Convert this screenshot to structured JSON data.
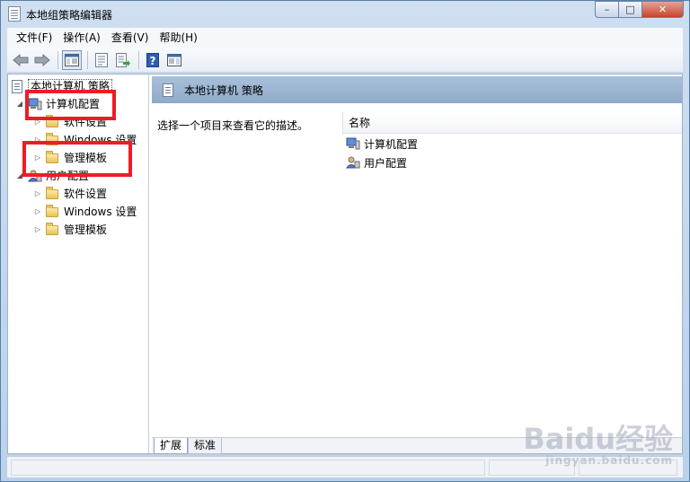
{
  "window": {
    "title": "本地组策略编辑器",
    "buttons": {
      "minimize": "–",
      "maximize": "□",
      "close": "✕"
    }
  },
  "menu": [
    "文件(F)",
    "操作(A)",
    "查看(V)",
    "帮助(H)"
  ],
  "toolbar": {
    "buttons": [
      "back-arrow-icon",
      "forward-arrow-icon",
      "show-hide-tree-icon",
      "properties-icon",
      "export-list-icon",
      "help-icon",
      "show-hide-action-pane-icon"
    ]
  },
  "tree": {
    "root": "本地计算机 策略",
    "computer_config": "计算机配置",
    "computer_children": [
      "软件设置",
      "Windows 设置",
      "管理模板"
    ],
    "user_config": "用户配置",
    "user_children": [
      "软件设置",
      "Windows 设置",
      "管理模板"
    ]
  },
  "right_pane": {
    "header_title": "本地计算机 策略",
    "description": "选择一个项目来查看它的描述。",
    "column_name": "名称",
    "items": [
      "计算机配置",
      "用户配置"
    ]
  },
  "tabs": [
    "扩展",
    "标准"
  ],
  "watermark": {
    "main": "Baidu经验",
    "sub": "jingyan.baidu.com"
  },
  "colors": {
    "highlight": "#ee1c25",
    "pane_header": "#8faac8"
  }
}
